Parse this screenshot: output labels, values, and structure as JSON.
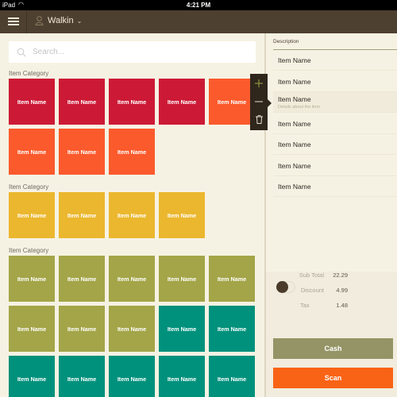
{
  "status_bar": {
    "device": "iPad",
    "time": "4:21 PM"
  },
  "header": {
    "menu_icon": "hamburger-icon",
    "customer_icon": "person-icon",
    "customer_name": "Walkin",
    "dropdown_icon": "chevron-down-icon"
  },
  "search": {
    "placeholder": "Search...",
    "value": ""
  },
  "colors": {
    "crimson": "#cc1a36",
    "orange": "#fb5a2c",
    "yellow": "#ebb72e",
    "olive": "#a3a548",
    "teal": "#00917c",
    "cash": "#959466",
    "scan": "#f96316",
    "header": "#4e4031"
  },
  "categories": [
    {
      "label": "Item Category",
      "items": [
        {
          "name": "Item Name",
          "color": "#cc1a36"
        },
        {
          "name": "Item Name",
          "color": "#cc1a36"
        },
        {
          "name": "Item Name",
          "color": "#cc1a36"
        },
        {
          "name": "Item Name",
          "color": "#cc1a36"
        },
        {
          "name": "Item Name",
          "color": "#fb5a2c"
        },
        {
          "name": "Item Name",
          "color": "#fb5a2c"
        },
        {
          "name": "Item Name",
          "color": "#fb5a2c"
        },
        {
          "name": "Item Name",
          "color": "#fb5a2c"
        }
      ]
    },
    {
      "label": "Item Category",
      "items": [
        {
          "name": "Item Name",
          "color": "#ebb72e"
        },
        {
          "name": "Item Name",
          "color": "#ebb72e"
        },
        {
          "name": "Item Name",
          "color": "#ebb72e"
        },
        {
          "name": "Item Name",
          "color": "#ebb72e"
        }
      ]
    },
    {
      "label": "Item Category",
      "items": [
        {
          "name": "Item Name",
          "color": "#a3a548"
        },
        {
          "name": "Item Name",
          "color": "#a3a548"
        },
        {
          "name": "Item Name",
          "color": "#a3a548"
        },
        {
          "name": "Item Name",
          "color": "#a3a548"
        },
        {
          "name": "Item Name",
          "color": "#a3a548"
        },
        {
          "name": "Item Name",
          "color": "#a3a548"
        },
        {
          "name": "Item Name",
          "color": "#a3a548"
        },
        {
          "name": "Item Name",
          "color": "#a3a548"
        },
        {
          "name": "Item Name",
          "color": "#00917c"
        },
        {
          "name": "Item Name",
          "color": "#00917c"
        },
        {
          "name": "Item Name",
          "color": "#00917c"
        },
        {
          "name": "Item Name",
          "color": "#00917c"
        },
        {
          "name": "Item Name",
          "color": "#00917c"
        },
        {
          "name": "Item Name",
          "color": "#00917c"
        },
        {
          "name": "Item Name",
          "color": "#00917c"
        }
      ]
    }
  ],
  "popover": {
    "add_icon": "plus-icon",
    "remove_icon": "minus-icon",
    "delete_icon": "trash-icon"
  },
  "order": {
    "column_header": "Description",
    "lines": [
      {
        "name": "Item Name",
        "details": ""
      },
      {
        "name": "Item Name",
        "details": ""
      },
      {
        "name": "Item Name",
        "details": "Details about the item",
        "selected": true
      },
      {
        "name": "Item Name",
        "details": ""
      },
      {
        "name": "Item Name",
        "details": ""
      },
      {
        "name": "Item Name",
        "details": ""
      },
      {
        "name": "Item Name",
        "details": ""
      }
    ]
  },
  "totals": {
    "subtotal_label": "Sub Total",
    "subtotal": "22.29",
    "discount_label": "Discount",
    "discount": "4.99",
    "tax_label": "Tax",
    "tax": "1.48",
    "tax_toggle_on": true
  },
  "actions": {
    "cash_label": "Cash",
    "scan_label": "Scan"
  }
}
